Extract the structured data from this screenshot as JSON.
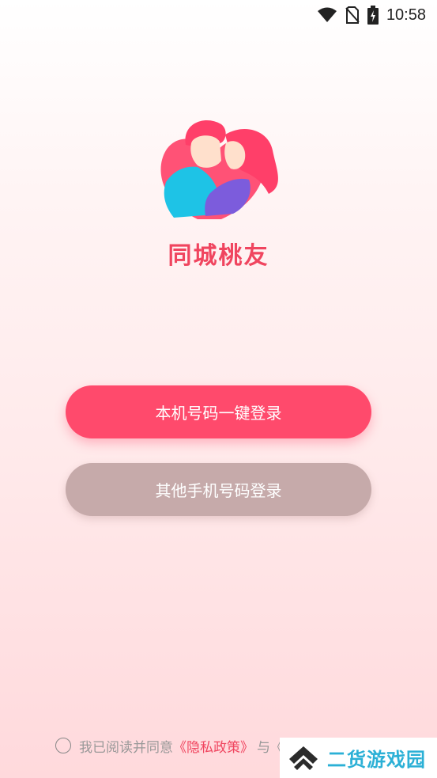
{
  "status_bar": {
    "time": "10:58",
    "icons": [
      "wifi-icon",
      "no-sim-icon",
      "battery-charging-icon"
    ]
  },
  "app": {
    "name": "同城桃友",
    "logo": "couple-logo"
  },
  "login": {
    "one_click_label": "本机号码一键登录",
    "other_phone_label": "其他手机号码登录"
  },
  "agreement": {
    "prefix": "我已阅读并同意",
    "privacy_policy": "《隐私政策》",
    "rest": "与《用户协议》"
  },
  "watermark": {
    "text": "二货游戏园",
    "icon": "chevron-up-logo-icon"
  },
  "colors": {
    "primary": "#ff4a6c",
    "secondary": "#c6aaaa",
    "brand_text": "#f0455f"
  }
}
